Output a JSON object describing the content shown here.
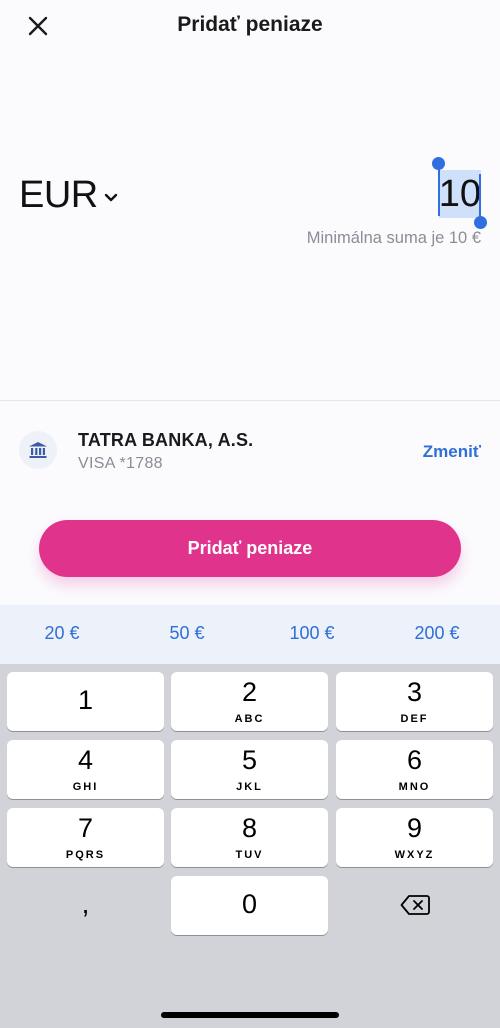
{
  "header": {
    "title": "Pridať peniaze",
    "close_icon": "close-icon"
  },
  "amount": {
    "currency": "EUR",
    "value": "10",
    "min_note": "Minimálna suma je 10 €"
  },
  "payment_method": {
    "bank_name": "TATRA BANKA, A.S.",
    "card": "VISA *1788",
    "change_label": "Zmeniť",
    "icon": "bank-icon"
  },
  "primary_button": {
    "label": "Pridať peniaze"
  },
  "quick_amounts": [
    "20 €",
    "50 €",
    "100 €",
    "200 €"
  ],
  "keyboard": {
    "keys": [
      {
        "digit": "1",
        "letters": ""
      },
      {
        "digit": "2",
        "letters": "ABC"
      },
      {
        "digit": "3",
        "letters": "DEF"
      },
      {
        "digit": "4",
        "letters": "GHI"
      },
      {
        "digit": "5",
        "letters": "JKL"
      },
      {
        "digit": "6",
        "letters": "MNO"
      },
      {
        "digit": "7",
        "letters": "PQRS"
      },
      {
        "digit": "8",
        "letters": "TUV"
      },
      {
        "digit": "9",
        "letters": "WXYZ"
      },
      {
        "digit": "0",
        "letters": ""
      }
    ],
    "comma": ",",
    "delete_icon": "backspace-icon"
  },
  "colors": {
    "accent": "#e0338c",
    "link": "#2f6fd6",
    "selection": "#cfe0fb"
  }
}
